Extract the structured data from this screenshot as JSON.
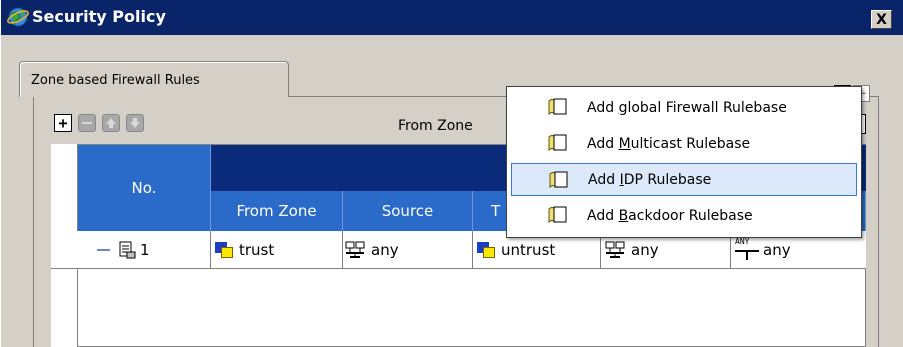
{
  "window": {
    "title": "Security Policy",
    "close_label": "X"
  },
  "tab": {
    "label": "Zone based Firewall Rules"
  },
  "expand_buttons": [
    "+",
    "−"
  ],
  "toolbar": {
    "add_label": "+",
    "filter_label": "From Zone"
  },
  "table": {
    "header_no": "No.",
    "columns": [
      "From Zone",
      "Source",
      "T"
    ],
    "row": {
      "no": "1",
      "from_zone": "trust",
      "source": "any",
      "to_zone": "untrust",
      "destination": "any",
      "service": "any",
      "service_badge": "ANY"
    }
  },
  "menu": {
    "items": [
      {
        "prefix": "Add ",
        "mnemonic": "g",
        "suffix": "lobal Firewall Rulebase",
        "selected": false
      },
      {
        "prefix": "Add ",
        "mnemonic": "M",
        "suffix": "ulticast Rulebase",
        "selected": false
      },
      {
        "prefix": "Add ",
        "mnemonic": "I",
        "suffix": "DP Rulebase",
        "selected": true
      },
      {
        "prefix": "Add ",
        "mnemonic": "B",
        "suffix": "ackdoor Rulebase",
        "selected": false
      }
    ]
  },
  "colors": {
    "titlebar": "#0a246a",
    "header_blue": "#2a6ac8",
    "header_band": "#0a2a7a",
    "menu_selected": "#dbe9fb"
  },
  "icons": [
    "globe-icon",
    "close-icon",
    "plus-icon",
    "minus-icon",
    "up-arrow-icon",
    "down-arrow-icon",
    "zone-icon",
    "network-icon",
    "rulebase-icon"
  ]
}
